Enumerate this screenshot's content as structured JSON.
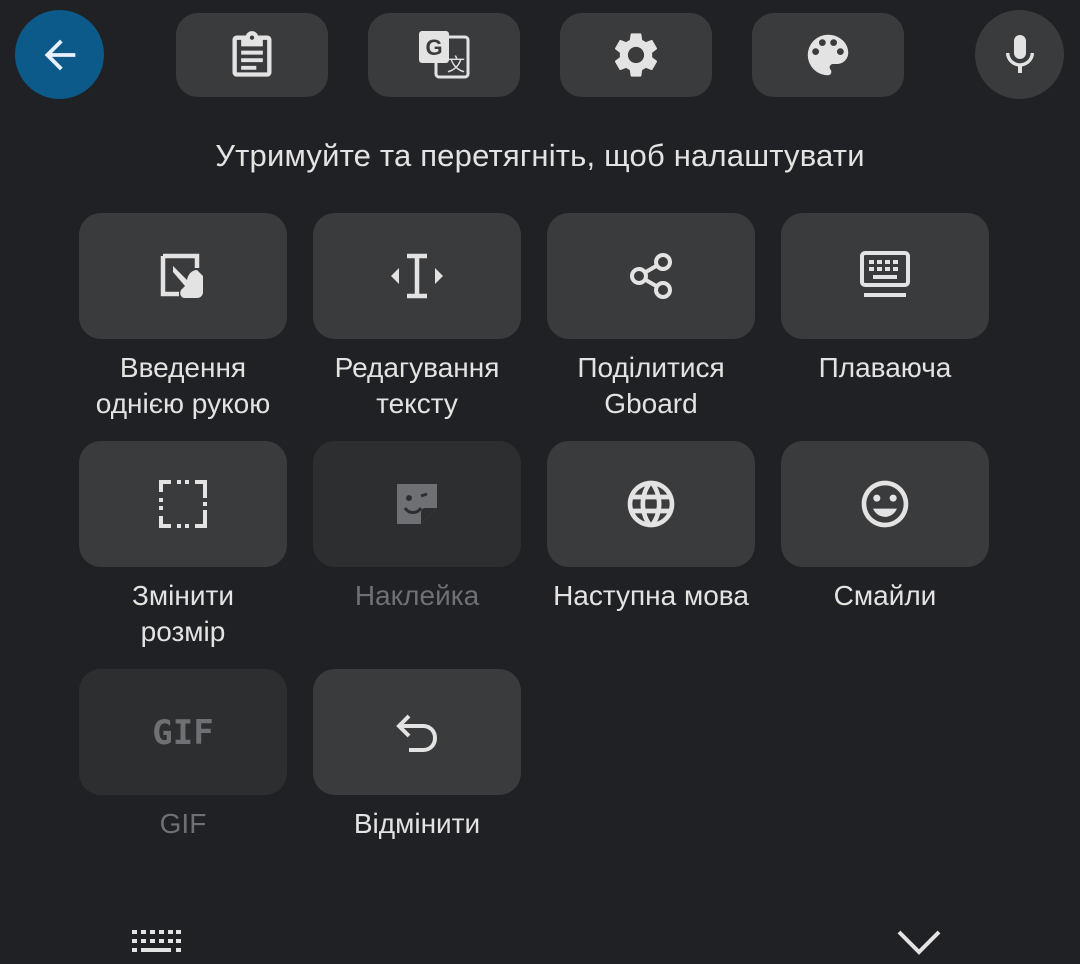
{
  "toolbar": {
    "back_icon": "arrow-left-icon",
    "buttons": [
      {
        "icon": "clipboard-icon"
      },
      {
        "icon": "translate-icon"
      },
      {
        "icon": "gear-icon"
      },
      {
        "icon": "palette-icon"
      }
    ],
    "mic_icon": "microphone-icon"
  },
  "hint": "Утримуйте та перетягніть, щоб налаштувати",
  "tiles": [
    {
      "label": "Введення\nоднією рукою",
      "icon": "one-hand-icon",
      "enabled": true
    },
    {
      "label": "Редагування\nтексту",
      "icon": "text-cursor-icon",
      "enabled": true
    },
    {
      "label": "Поділитися\nGboard",
      "icon": "share-icon",
      "enabled": true
    },
    {
      "label": "Плаваюча",
      "icon": "floating-keyboard-icon",
      "enabled": true
    },
    {
      "label": "Змінити\nрозмір",
      "icon": "resize-icon",
      "enabled": true
    },
    {
      "label": "Наклейка",
      "icon": "sticker-icon",
      "enabled": false
    },
    {
      "label": "Наступна мова",
      "icon": "globe-icon",
      "enabled": true
    },
    {
      "label": "Смайли",
      "icon": "smiley-icon",
      "enabled": true
    },
    {
      "label": "GIF",
      "icon": "gif-icon",
      "icon_text": "GIF",
      "enabled": false
    },
    {
      "label": "Відмінити",
      "icon": "undo-icon",
      "enabled": true
    }
  ],
  "bottom": {
    "left_icon": "keyboard-icon",
    "right_icon": "chevron-down-icon"
  },
  "colors": {
    "background": "#202124",
    "button": "#3a3b3d",
    "button_disabled": "#2d2e30",
    "accent": "#0b5a8a",
    "text": "#e3e3e3",
    "text_disabled": "#6f7073"
  }
}
